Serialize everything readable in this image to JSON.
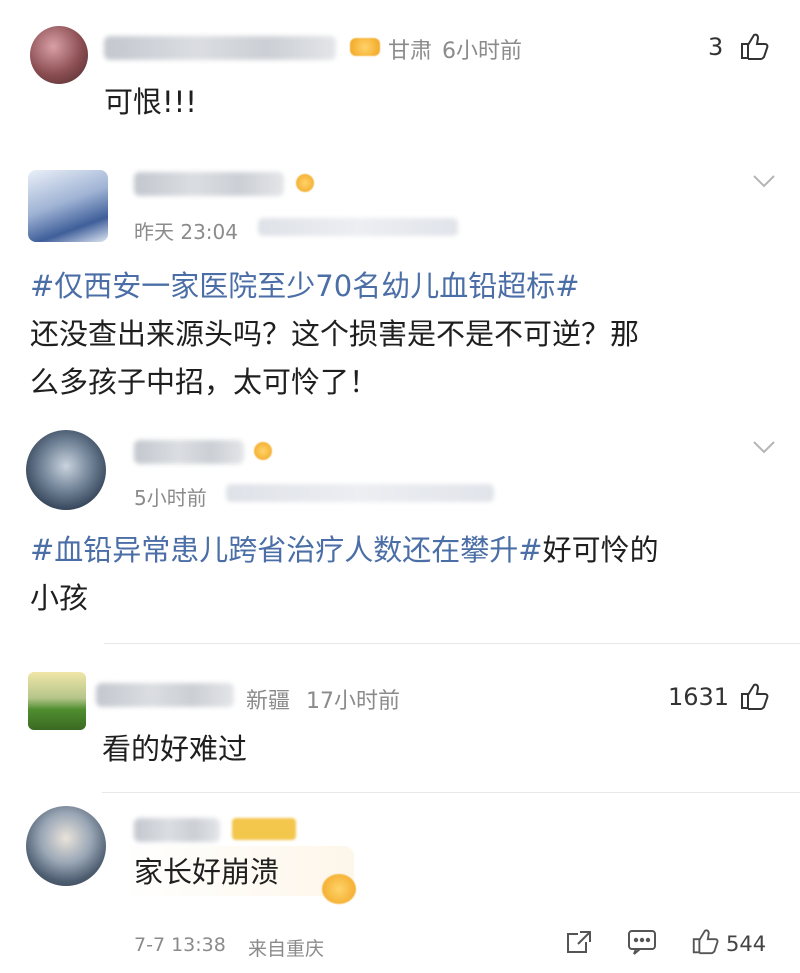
{
  "comments": [
    {
      "location": "甘肃",
      "time": "6小时前",
      "likes": "3",
      "text": "可恨!!!"
    },
    {
      "time": "昨天 23:04",
      "hashtag": "#仅西安一家医院至少70名幼儿血铅超标#",
      "text_line1": "还没查出来源头吗？这个损害是不是不可逆？那",
      "text_line2": "么多孩子中招，太可怜了！"
    },
    {
      "time": "5小时前",
      "hashtag": "#血铅异常患儿跨省治疗人数还在攀升#",
      "text_after": "好可怜的",
      "text_line2": "小孩"
    },
    {
      "location": "新疆",
      "time": "17小时前",
      "likes": "1631",
      "text": "看的好难过"
    },
    {
      "text": "家长好崩溃",
      "date": "7-7 13:38",
      "source": "来自重庆",
      "likes": "544"
    }
  ],
  "colors": {
    "hashtag": "#4b6ea7",
    "meta": "#8b8b8b",
    "text": "#1f1f1f"
  }
}
